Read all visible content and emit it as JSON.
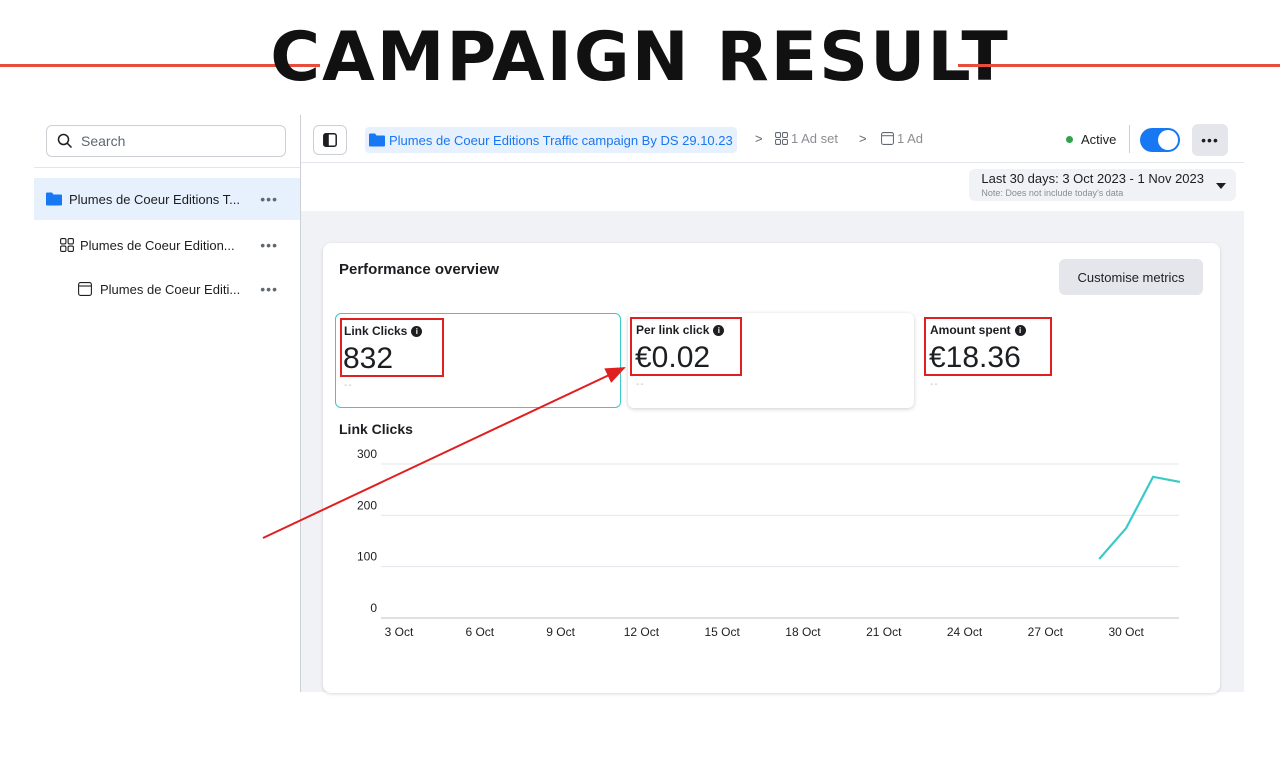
{
  "page_title": "CAMPAIGN RESULT",
  "sidebar": {
    "search_placeholder": "Search",
    "items": [
      {
        "label": "Plumes de Coeur Editions T...",
        "more": "•••"
      },
      {
        "label": "Plumes de Coeur Edition...",
        "more": "•••"
      },
      {
        "label": "Plumes de Coeur Editi...",
        "more": "•••"
      }
    ]
  },
  "breadcrumb": {
    "campaign": "Plumes de Coeur Editions Traffic campaign By DS 29.10.23",
    "sep": ">",
    "ad_set": "1 Ad set",
    "ad": "1 Ad"
  },
  "status": {
    "label": "Active",
    "toggle_on": true,
    "more": "•••"
  },
  "date_range": {
    "main": "Last 30 days: 3 Oct 2023 - 1 Nov 2023",
    "note": "Note: Does not include today's data"
  },
  "overview": {
    "title": "Performance overview",
    "customise_label": "Customise metrics",
    "metrics": [
      {
        "label": "Link Clicks",
        "value": "832",
        "compare": "--"
      },
      {
        "label": "Per link click",
        "value": "€0.02",
        "compare": "--"
      },
      {
        "label": "Amount spent",
        "value": "€18.36",
        "compare": "--"
      }
    ]
  },
  "colors": {
    "accent": "#1877f2",
    "line": "#3bc9c9",
    "highlight": "#e02020",
    "title_rule": "#e74c3c"
  },
  "chart_data": {
    "type": "line",
    "title": "Link Clicks",
    "xlabel": "",
    "ylabel": "",
    "ylim": [
      0,
      300
    ],
    "yticks": [
      "300",
      "200",
      "100",
      "0"
    ],
    "x_tick_labels": [
      "3 Oct",
      "6 Oct",
      "9 Oct",
      "12 Oct",
      "15 Oct",
      "18 Oct",
      "21 Oct",
      "24 Oct",
      "27 Oct",
      "30 Oct"
    ],
    "x_start_day": 3,
    "x_end_day": 32,
    "points": [
      {
        "day": 29,
        "value": 115
      },
      {
        "day": 30,
        "value": 175
      },
      {
        "day": 31,
        "value": 275
      },
      {
        "day": 32,
        "value": 265
      }
    ],
    "grid": true
  }
}
